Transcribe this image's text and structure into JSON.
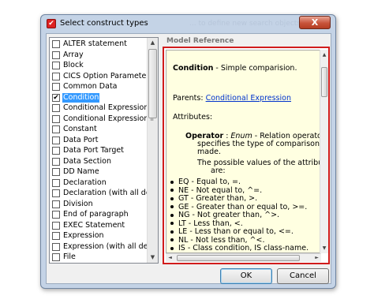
{
  "window": {
    "title": "Select construct types",
    "title_ghost": "... to define new search objects...",
    "close_symbol": "X"
  },
  "construct_list": {
    "items": [
      {
        "label": "ALTER statement",
        "checked": false,
        "selected": false
      },
      {
        "label": "Array",
        "checked": false,
        "selected": false
      },
      {
        "label": "Block",
        "checked": false,
        "selected": false
      },
      {
        "label": "CICS Option Parameter",
        "checked": false,
        "selected": false
      },
      {
        "label": "Common Data",
        "checked": false,
        "selected": false
      },
      {
        "label": "Condition",
        "checked": true,
        "selected": true
      },
      {
        "label": "Conditional Expression",
        "checked": false,
        "selected": false
      },
      {
        "label": "Conditional Expression (…",
        "checked": false,
        "selected": false
      },
      {
        "label": "Constant",
        "checked": false,
        "selected": false
      },
      {
        "label": "Data Port",
        "checked": false,
        "selected": false
      },
      {
        "label": "Data Port Target",
        "checked": false,
        "selected": false
      },
      {
        "label": "Data Section",
        "checked": false,
        "selected": false
      },
      {
        "label": "DD Name",
        "checked": false,
        "selected": false
      },
      {
        "label": "Declaration",
        "checked": false,
        "selected": false
      },
      {
        "label": "Declaration (with all desc…",
        "checked": false,
        "selected": false
      },
      {
        "label": "Division",
        "checked": false,
        "selected": false
      },
      {
        "label": "End of paragraph",
        "checked": false,
        "selected": false
      },
      {
        "label": "EXEC Statement",
        "checked": false,
        "selected": false
      },
      {
        "label": "Expression",
        "checked": false,
        "selected": false
      },
      {
        "label": "Expression (with all desc…",
        "checked": false,
        "selected": false
      },
      {
        "label": "File",
        "checked": false,
        "selected": false
      }
    ],
    "check_mark": "✔",
    "scroll_up": "▲",
    "scroll_down": "▼"
  },
  "reference": {
    "header": "Model Reference",
    "name": "Condition",
    "name_desc": " - Simple comparision.",
    "parents_label": "Parents: ",
    "parents_link": "Conditional Expression",
    "attributes_label": "Attributes:",
    "operator_name": "Operator",
    "operator_type": "Enum",
    "operator_desc_1": " - Relation operator,",
    "operator_desc_2": "specifies the type of comparison to be",
    "operator_desc_3": "made.",
    "possible_1": "The possible values of the attribute",
    "possible_2": "are:",
    "values": [
      "EQ - Equal to, =.",
      "NE - Not equal to, ^=.",
      "GT - Greater than, >.",
      "GE - Greater than or equal to, >=.",
      "NG - Not greater than, ^>.",
      "LT - Less than, <.",
      "LE - Less than or equal to, <=.",
      "NL - Not less than, ^<.",
      "IS - Class condition, IS class-name."
    ],
    "hscroll_left": "◄",
    "hscroll_right": "►",
    "vscroll_up": "▲",
    "vscroll_down": "▼"
  },
  "buttons": {
    "ok": "OK",
    "cancel": "Cancel"
  },
  "colors": {
    "selection": "#3399ff",
    "highlight_border": "#d11c1c",
    "reference_bg": "#ffffe1",
    "link": "#0033cc"
  }
}
